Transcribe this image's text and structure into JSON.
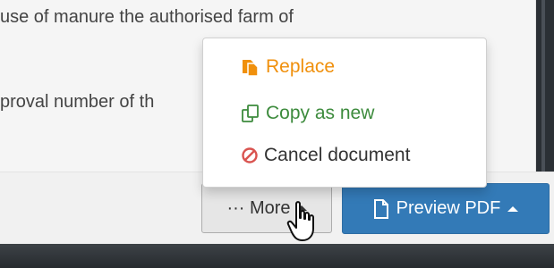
{
  "document": {
    "line1": "use of manure the authorised farm of",
    "line2": "proval number of th"
  },
  "dropdown": {
    "items": [
      {
        "label": "Replace",
        "icon": "replace-icon",
        "color": "#f0900c"
      },
      {
        "label": "Copy as new",
        "icon": "copy-icon",
        "color": "#3d8b3d"
      },
      {
        "label": "Cancel document",
        "icon": "cancel-icon",
        "color": "#333333"
      }
    ],
    "cancel_icon_color": "#d9534f"
  },
  "footer": {
    "more_label": "··· More",
    "preview_label": "Preview PDF"
  },
  "colors": {
    "primary": "#337ab7",
    "default_button": "#e6e6e6"
  }
}
